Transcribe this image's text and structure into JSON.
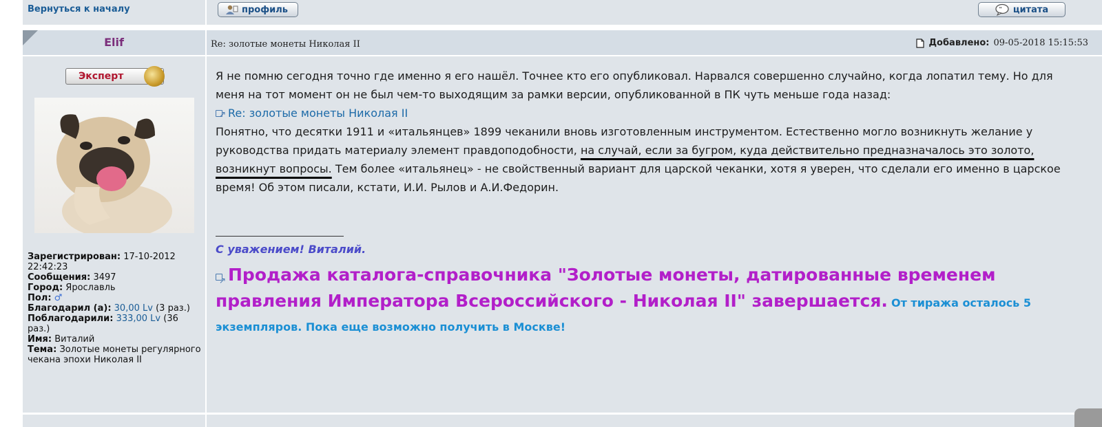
{
  "nav": {
    "back_to_top": "Вернуться к началу",
    "profile_button": "профиль",
    "quote_button": "цитата"
  },
  "post": {
    "author": "Elif",
    "title": "Re: золотые монеты Николая II",
    "added_label": "Добавлено:",
    "added_date": "09-05-2018 15:15:53",
    "body": {
      "para1": "Я не помню сегодня точно где именно я его нашёл. Точнее кто его опубликовал. Нарвался совершенно случайно, когда лопатил тему. Но для меня на тот момент он не был чем-то выходящим за рамки версии, опубликованной в ПК чуть меньше года назад:",
      "link_text": "Re: золотые монеты Николая II",
      "para2_a": "Понятно, что десятки 1911 и «итальянцев» 1899 чеканили вновь изготовленным инструментом. Естественно могло возникнуть желание у руководства придать материалу элемент правдоподобности, ",
      "para2_underlined": "на случай, если за бугром, куда действительно предназначалось это золото, возникнут вопросы.",
      "para2_b": " Тем более «итальянец» - не свойственный вариант для царской чеканки, хотя я уверен, что сделали его именно в царское время! Об этом писали, кстати, И.И. Рылов и А.И.Федорин."
    },
    "signature": {
      "greeting": "С уважением! Виталий.",
      "promo_big": "Продажа каталога-справочника \"Золотые монеты, датированные временем правления Императора Всероссийского - Николая II\" завершается.",
      "promo_small": "От тиража осталось 5 экземпляров. Пока еще возможно получить в Москве!"
    }
  },
  "user": {
    "rank": "Эксперт",
    "registered_label": "Зарегистрирован:",
    "registered_value": "17-10-2012 22:42:23",
    "posts_label": "Сообщения:",
    "posts_value": "3497",
    "city_label": "Город:",
    "city_value": "Ярославль",
    "gender_label": "Пол:",
    "gender_value": "♂",
    "thanked_label": "Благодарил (а):",
    "thanked_value": "30,00 Lv",
    "thanked_count": "(3 раз.)",
    "thanked_by_label": "Поблагодарили:",
    "thanked_by_value": "333,00 Lv",
    "thanked_by_count": "(36 раз.)",
    "name_label": "Имя:",
    "name_value": "Виталий",
    "topic_label": "Тема:",
    "topic_value": "Золотые монеты регулярного чекана эпохи Николая II"
  }
}
